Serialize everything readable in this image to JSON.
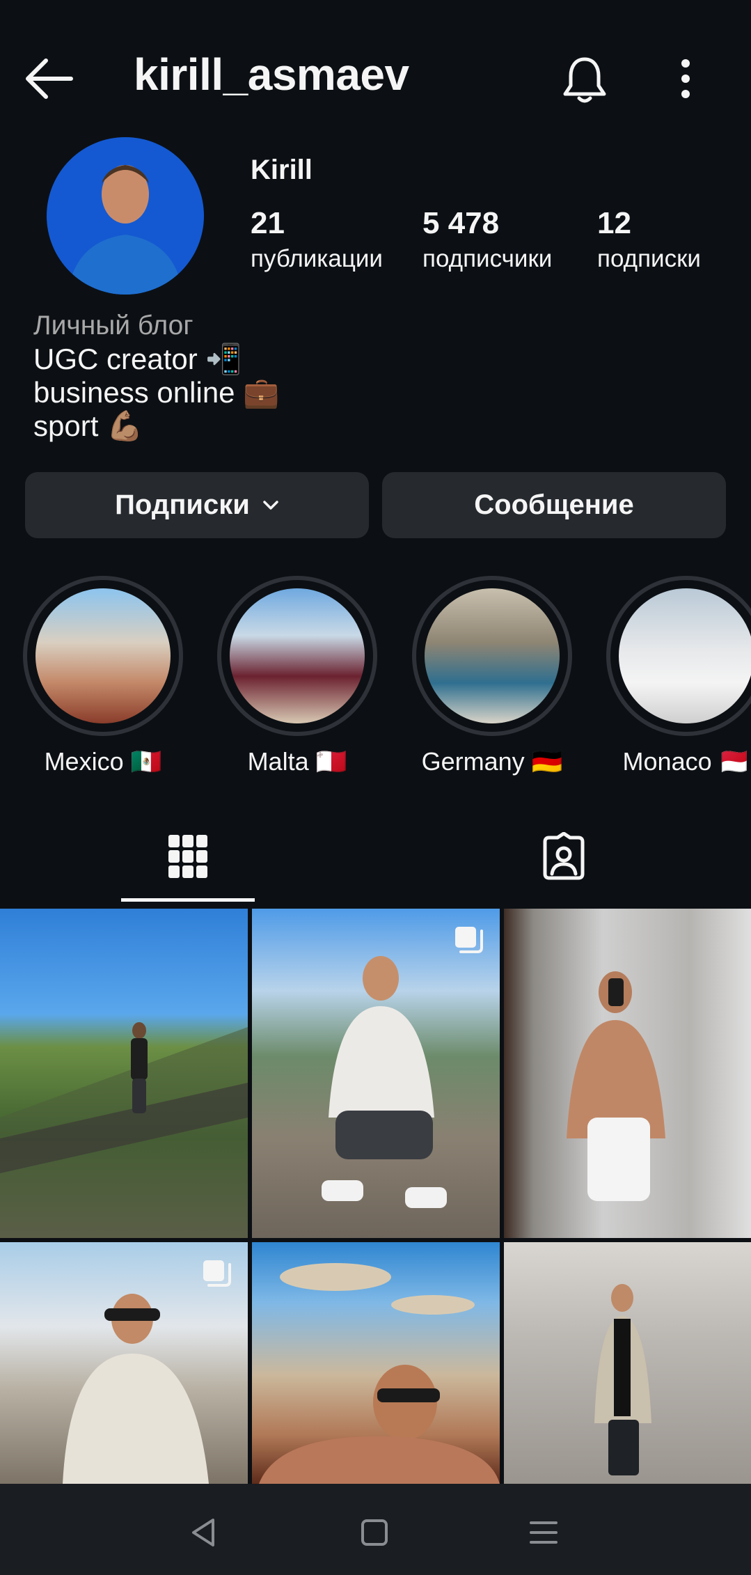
{
  "header": {
    "username": "kirill_asmaev"
  },
  "profile": {
    "display_name": "Kirill",
    "stats": [
      {
        "value": "21",
        "label": "публикации"
      },
      {
        "value": "5 478",
        "label": "подписчики"
      },
      {
        "value": "12",
        "label": "подписки"
      }
    ],
    "bio": {
      "category": "Личный блог",
      "lines": [
        "UGC creator 📲",
        "business online 💼",
        "sport 💪🏽"
      ]
    }
  },
  "actions": {
    "following_label": "Подписки",
    "message_label": "Сообщение"
  },
  "highlights": [
    {
      "label": "Mexico 🇲🇽"
    },
    {
      "label": "Malta 🇲🇹"
    },
    {
      "label": "Germany 🇩🇪"
    },
    {
      "label": "Monaco 🇲🇨"
    }
  ],
  "tabs": [
    {
      "icon": "grid-icon",
      "active": true
    },
    {
      "icon": "tagged-icon",
      "active": false
    }
  ],
  "posts": [
    {
      "multiple": false
    },
    {
      "multiple": true
    },
    {
      "multiple": false
    },
    {
      "multiple": true
    },
    {
      "multiple": false
    },
    {
      "multiple": false
    }
  ],
  "navigation": [
    "back-icon",
    "home-icon",
    "menu-icon"
  ],
  "colors": {
    "background": "#0c1014",
    "button": "#262a2f",
    "text": "#f5f5f5",
    "secondary_text": "#a8a8a8"
  }
}
